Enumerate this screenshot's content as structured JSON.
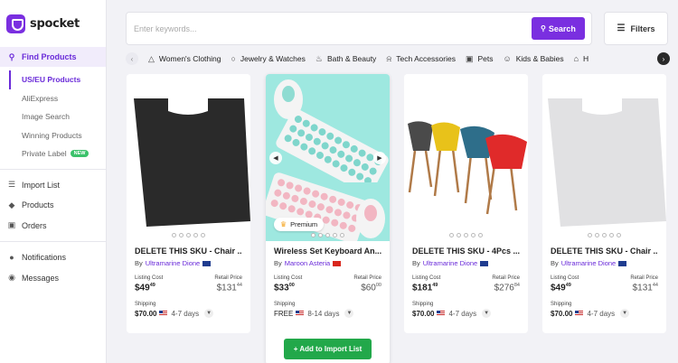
{
  "app": {
    "name": "spocket"
  },
  "sidebar": {
    "find_products": "Find Products",
    "sub_items": [
      {
        "label": "US/EU Products"
      },
      {
        "label": "AliExpress"
      },
      {
        "label": "Image Search"
      },
      {
        "label": "Winning Products"
      },
      {
        "label": "Private Label",
        "badge": "NEW"
      }
    ],
    "items": [
      {
        "label": "Import List",
        "icon": "list-icon"
      },
      {
        "label": "Products",
        "icon": "tag-icon"
      },
      {
        "label": "Orders",
        "icon": "cart-icon"
      }
    ],
    "secondary": [
      {
        "label": "Notifications",
        "icon": "bell-icon"
      },
      {
        "label": "Messages",
        "icon": "chat-icon"
      }
    ]
  },
  "search": {
    "placeholder": "Enter keywords...",
    "button": "Search",
    "value": ""
  },
  "filters": {
    "label": "Filters"
  },
  "categories": [
    {
      "label": "Women's Clothing",
      "icon": "dress-icon"
    },
    {
      "label": "Jewelry & Watches",
      "icon": "ring-icon"
    },
    {
      "label": "Bath & Beauty",
      "icon": "bath-icon"
    },
    {
      "label": "Tech Accessories",
      "icon": "headphones-icon"
    },
    {
      "label": "Pets",
      "icon": "pet-icon"
    },
    {
      "label": "Kids & Babies",
      "icon": "baby-icon"
    },
    {
      "label": "H",
      "icon": "home-icon"
    }
  ],
  "products": [
    {
      "title": "DELETE THIS SKU - Chair ...",
      "by": "By",
      "seller": "Ultramarine Dione",
      "origin": "AU",
      "listing_label": "Listing Cost",
      "listing_price": "$49",
      "listing_cents": "49",
      "retail_label": "Retail Price",
      "retail_price": "$131",
      "retail_cents": "44",
      "shipping_label": "Shipping",
      "shipping_cost": "$70.00",
      "shipping_days": "4-7 days"
    },
    {
      "title": "Wireless Set Keyboard An...",
      "by": "By",
      "seller": "Maroon Asteria",
      "origin": "CN",
      "listing_label": "Listing Cost",
      "listing_price": "$33",
      "listing_cents": "00",
      "retail_label": "Retail Price",
      "retail_price": "$60",
      "retail_cents": "00",
      "shipping_label": "Shipping",
      "shipping_cost": "FREE",
      "shipping_days": "8-14 days",
      "premium": "Premium",
      "add_button": "+ Add to Import List"
    },
    {
      "title": "DELETE THIS SKU - 4Pcs ...",
      "by": "By",
      "seller": "Ultramarine Dione",
      "origin": "AU",
      "listing_label": "Listing Cost",
      "listing_price": "$181",
      "listing_cents": "49",
      "retail_label": "Retail Price",
      "retail_price": "$276",
      "retail_cents": "84",
      "shipping_label": "Shipping",
      "shipping_cost": "$70.00",
      "shipping_days": "4-7 days"
    },
    {
      "title": "DELETE THIS SKU - Chair ...",
      "by": "By",
      "seller": "Ultramarine Dione",
      "origin": "AU",
      "listing_label": "Listing Cost",
      "listing_price": "$49",
      "listing_cents": "49",
      "retail_label": "Retail Price",
      "retail_price": "$131",
      "retail_cents": "44",
      "shipping_label": "Shipping",
      "shipping_cost": "$70.00",
      "shipping_days": "4-7 days"
    }
  ],
  "colors": {
    "brand": "#7a2fe0",
    "add_button": "#22a84a"
  }
}
